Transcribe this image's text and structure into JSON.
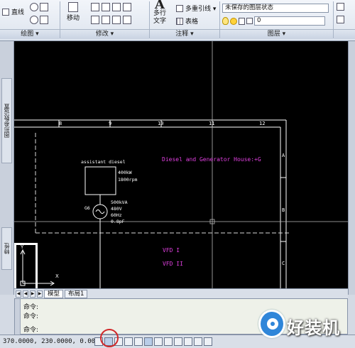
{
  "ribbon": {
    "draw": {
      "line_label": "直线",
      "panel": "绘图 ▾"
    },
    "modify": {
      "move_label": "移动",
      "panel": "修改 ▾"
    },
    "annotation": {
      "mtext_line1": "多行",
      "mtext_line2": "文字",
      "mleader_label": "多重引线 ▾",
      "table_label": "表格",
      "panel": "注释 ▾"
    },
    "layers": {
      "state_label": "未保存的图层状态",
      "layer_value": "0",
      "panel": "图层 ▾"
    }
  },
  "palettes": {
    "tool_palette": "图形参数设置",
    "properties": "特性"
  },
  "drawing": {
    "top_numbers": [
      "8",
      "9",
      "10",
      "11",
      "12"
    ],
    "right_letters": [
      "A",
      "B",
      "C"
    ],
    "title": "Diesel and Generator House:+G",
    "assistant_label": "assistant diesel",
    "engine_rating_1": "400kW",
    "engine_rating_2": "1800rpm",
    "gen_label": "G6",
    "gen_spec_1": "500kVA",
    "gen_spec_2": "480V",
    "gen_spec_3": "60Hz",
    "gen_spec_4": "0.8pF",
    "vfd_1": "VFD I",
    "vfd_2": "VFD II",
    "ucs_x": "X",
    "ucs_y": "Y",
    "colors": {
      "magenta": "#e040e0",
      "white": "#ffffff",
      "background": "#000000"
    }
  },
  "tabs": {
    "model": "模型",
    "layout1": "布局1"
  },
  "command": {
    "lines": [
      "命令:",
      "命令:",
      "命令:"
    ]
  },
  "status": {
    "coords": "370.0000, 230.0000, 0.0000"
  },
  "watermark": {
    "text": "好装机"
  }
}
